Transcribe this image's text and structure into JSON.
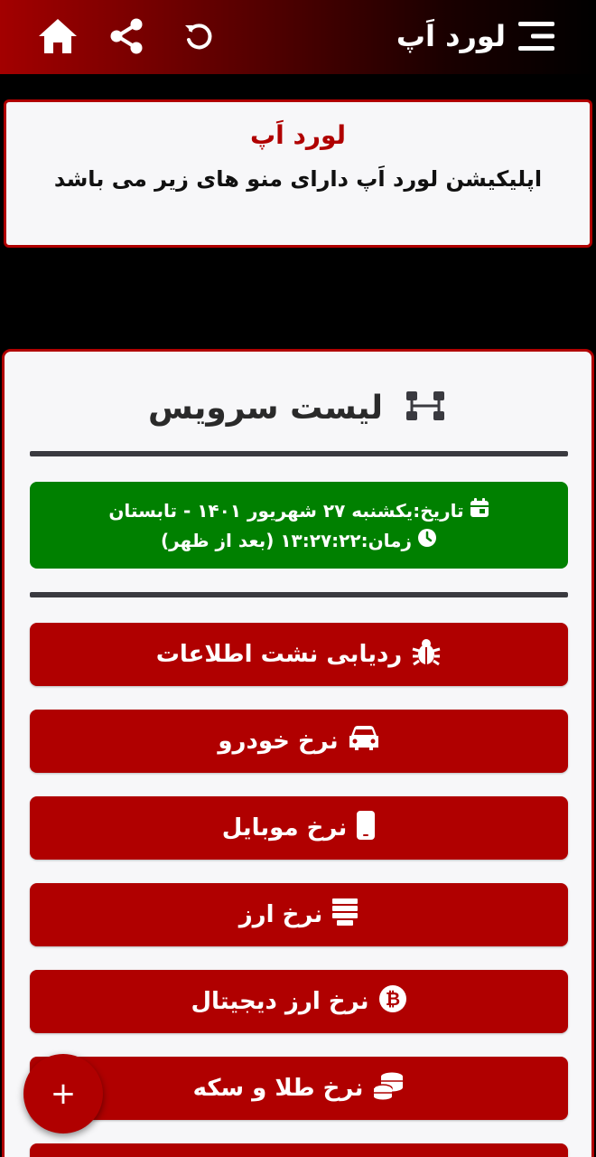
{
  "app_bar": {
    "title": "لورد اَپ",
    "icons": [
      "home-icon",
      "share-icon",
      "refresh-icon",
      "menu-icon"
    ]
  },
  "info_card": {
    "title": "لورد اَپ",
    "description": "اپلیکیشن لورد اَپ دارای منو های زیر می باشد"
  },
  "services": {
    "title": "لیست سرویس",
    "date_line": "تاریخ:یکشنبه ۲۷ شهریور ۱۴۰۱ - تابستان",
    "time_line": "زمان:۱۳:۲۷:۲۲ (بعد از ظهر)",
    "items": [
      {
        "label": "ردیابی نشت اطلاعات",
        "icon": "bug-icon"
      },
      {
        "label": "نرخ خودرو",
        "icon": "car-icon"
      },
      {
        "label": "نرخ موبایل",
        "icon": "mobile-icon"
      },
      {
        "label": "نرخ ارز",
        "icon": "money-icon"
      },
      {
        "label": "نرخ ارز دیجیتال",
        "icon": "bitcoin-icon"
      },
      {
        "label": "نرخ طلا و سکه",
        "icon": "coins-icon"
      }
    ]
  },
  "fab": {
    "label": "+"
  },
  "colors": {
    "primary": "#b00000",
    "date_box": "#008000",
    "divider": "#3a3a40",
    "card_bg": "#f7f7f9"
  }
}
